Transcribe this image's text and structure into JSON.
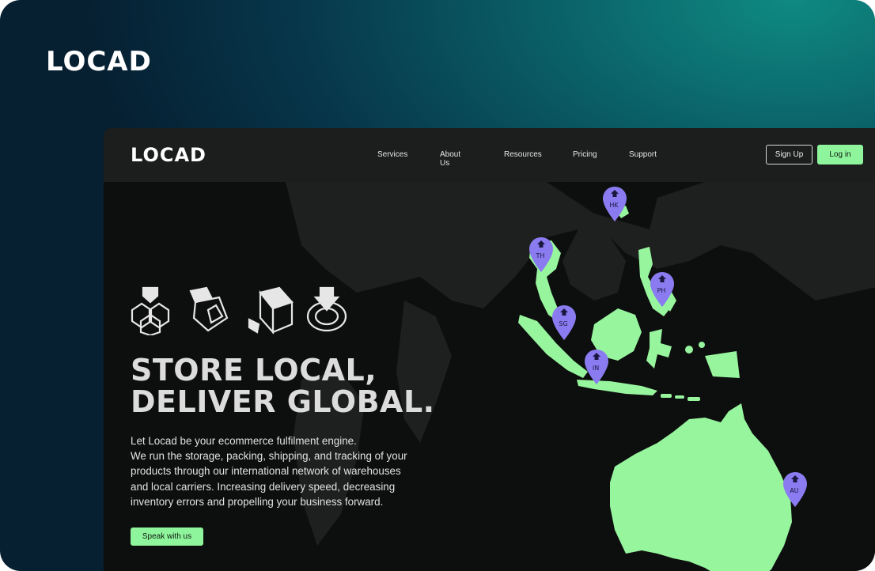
{
  "brand": {
    "outer_logo": "LOCAD",
    "nav_logo": "LOCAD"
  },
  "nav": {
    "links": [
      "Services",
      "About Us",
      "Resources",
      "Pricing",
      "Support"
    ],
    "signup_label": "Sign Up",
    "login_label": "Log in"
  },
  "hero": {
    "headline_line1": "STORE LOCAL,",
    "headline_line2": "DELIVER GLOBAL.",
    "body_line1": "Let Locad be your ecommerce fulfilment engine.",
    "body_line2": "We run the storage, packing, shipping, and tracking of your",
    "body_line3": "products through our international network of warehouses",
    "body_line4": "and local carriers. Increasing delivery speed, decreasing",
    "body_line5": "inventory errors and propelling your business forward.",
    "cta_label": "Speak with us",
    "icons": [
      "boxes-stack-icon",
      "unboxing-icon",
      "shipping-box-icon",
      "tracking-target-icon"
    ]
  },
  "map": {
    "pins": [
      "HK",
      "TH",
      "PH",
      "SG",
      "IN",
      "AU"
    ]
  },
  "colors": {
    "accent": "#8ff59c",
    "pin": "#8a7cf0",
    "land": "#97f59e",
    "background": "#0d0e0e"
  }
}
